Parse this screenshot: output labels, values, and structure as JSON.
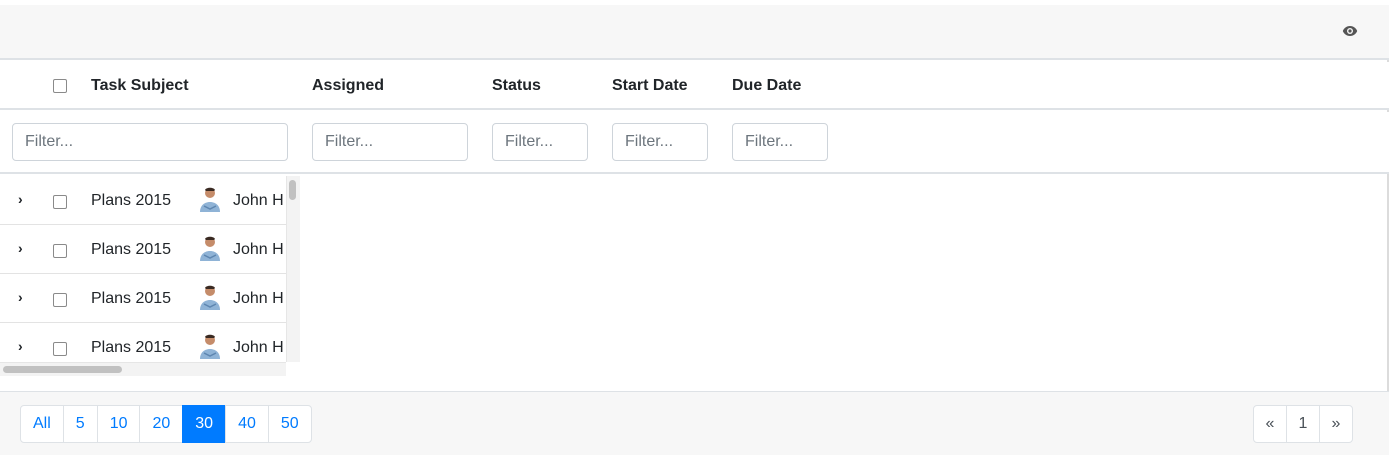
{
  "toolbar": {
    "view_icon": "eye-icon"
  },
  "columns": [
    "Task Subject",
    "Assigned",
    "Status",
    "Start Date",
    "Due Date"
  ],
  "filters": {
    "placeholder": "Filter...",
    "subject": "",
    "assigned": "",
    "status": "",
    "start_date": "",
    "due_date": ""
  },
  "rows": [
    {
      "subject": "Plans 2015",
      "assignee": "John H",
      "avatar": "avatar-icon"
    },
    {
      "subject": "Plans 2015",
      "assignee": "John H",
      "avatar": "avatar-icon"
    },
    {
      "subject": "Plans 2015",
      "assignee": "John H",
      "avatar": "avatar-icon"
    },
    {
      "subject": "Plans 2015",
      "assignee": "John H",
      "avatar": "avatar-icon"
    }
  ],
  "pager": {
    "page_sizes": [
      "All",
      "5",
      "10",
      "20",
      "30",
      "40",
      "50"
    ],
    "active_size": "30",
    "prev": "«",
    "current_page": "1",
    "next": "»"
  },
  "colors": {
    "accent": "#007bff",
    "toolbar_bg": "#f7f7f7",
    "border": "#dee2e6"
  }
}
